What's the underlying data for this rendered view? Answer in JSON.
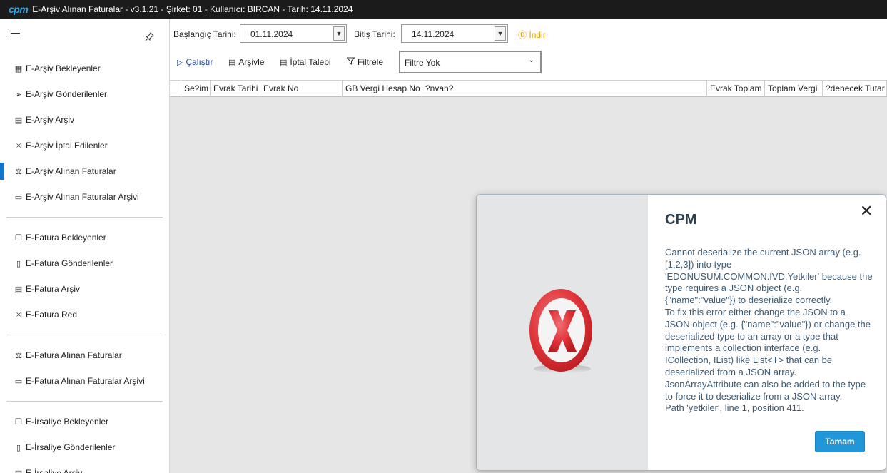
{
  "titlebar": {
    "logo": "cpm",
    "title": "E-Arşiv Alınan Faturalar - v3.1.21 - Şirket: 01 - Kullanıcı: BIRCAN - Tarih: 14.11.2024"
  },
  "sidebar": {
    "groups": [
      [
        {
          "label": "E-Arşiv Bekleyenler",
          "icon": "calculator-icon"
        },
        {
          "label": "E-Arşiv Gönderilenler",
          "icon": "send-icon"
        },
        {
          "label": "E-Arşiv Arşiv",
          "icon": "archive-icon"
        },
        {
          "label": "E-Arşiv İptal Edilenler",
          "icon": "cancel-doc-icon"
        },
        {
          "label": "E-Arşiv Alınan Faturalar",
          "icon": "inbox-icon",
          "active": true
        },
        {
          "label": "E-Arşiv Alınan Faturalar Arşivi",
          "icon": "folder-icon"
        }
      ],
      [
        {
          "label": "E-Fatura Bekleyenler",
          "icon": "documents-icon"
        },
        {
          "label": "E-Fatura Gönderilenler",
          "icon": "document-icon"
        },
        {
          "label": "E-Fatura Arşiv",
          "icon": "archive-icon"
        },
        {
          "label": "E-Fatura Red",
          "icon": "cancel-doc-icon"
        }
      ],
      [
        {
          "label": "E-Fatura Alınan Faturalar",
          "icon": "inbox-icon"
        },
        {
          "label": "E-Fatura Alınan Faturalar Arşivi",
          "icon": "folder-icon"
        }
      ],
      [
        {
          "label": "E-İrsaliye Bekleyenler",
          "icon": "documents-icon"
        },
        {
          "label": "E-İrsaliye Gönderilenler",
          "icon": "document-icon"
        },
        {
          "label": "E-İrsaliye Arşiv",
          "icon": "archive-icon"
        }
      ]
    ]
  },
  "toolbar": {
    "start_label": "Başlangıç Tarihi:",
    "start_value": "01.11.2024",
    "end_label": "Bitiş Tarihi:",
    "end_value": "14.11.2024",
    "download_label": "İndir",
    "run_label": "Çalıştır",
    "archive_label": "Arşivle",
    "cancel_request_label": "İptal Talebi",
    "filter_label": "Filtrele",
    "filter_value": "Filtre Yok"
  },
  "grid": {
    "columns": [
      "Se?im",
      "Evrak Tarihi",
      "Evrak No",
      "GB Vergi Hesap No",
      "?nvan?",
      "Evrak Toplam",
      "Toplam Vergi",
      "?denecek Tutar"
    ]
  },
  "dialog": {
    "title": "CPM",
    "message": "Cannot deserialize the current JSON array (e.g.\n[1,2,3]) into type\n'EDONUSUM.COMMON.IVD.Yetkiler' because the\ntype requires a JSON object (e.g.\n{\"name\":\"value\"}) to deserialize correctly.\nTo fix this error either change the JSON to a\nJSON object (e.g. {\"name\":\"value\"}) or change the\ndeserialized type to an array or a type that\nimplements a collection interface (e.g.\nICollection, IList) like List<T> that can be\ndeserialized from a JSON array.\nJsonArrayAttribute can also be added to the type\nto force it to deserialize from a JSON array.\nPath 'yetkiler', line 1, position 411.",
    "ok_label": "Tamam"
  },
  "colors": {
    "titlebar_bg": "#1b1b1b",
    "accent": "#1177cc",
    "download": "#e8a000",
    "ok_button": "#2196d9",
    "error_red": "#e0393e"
  }
}
